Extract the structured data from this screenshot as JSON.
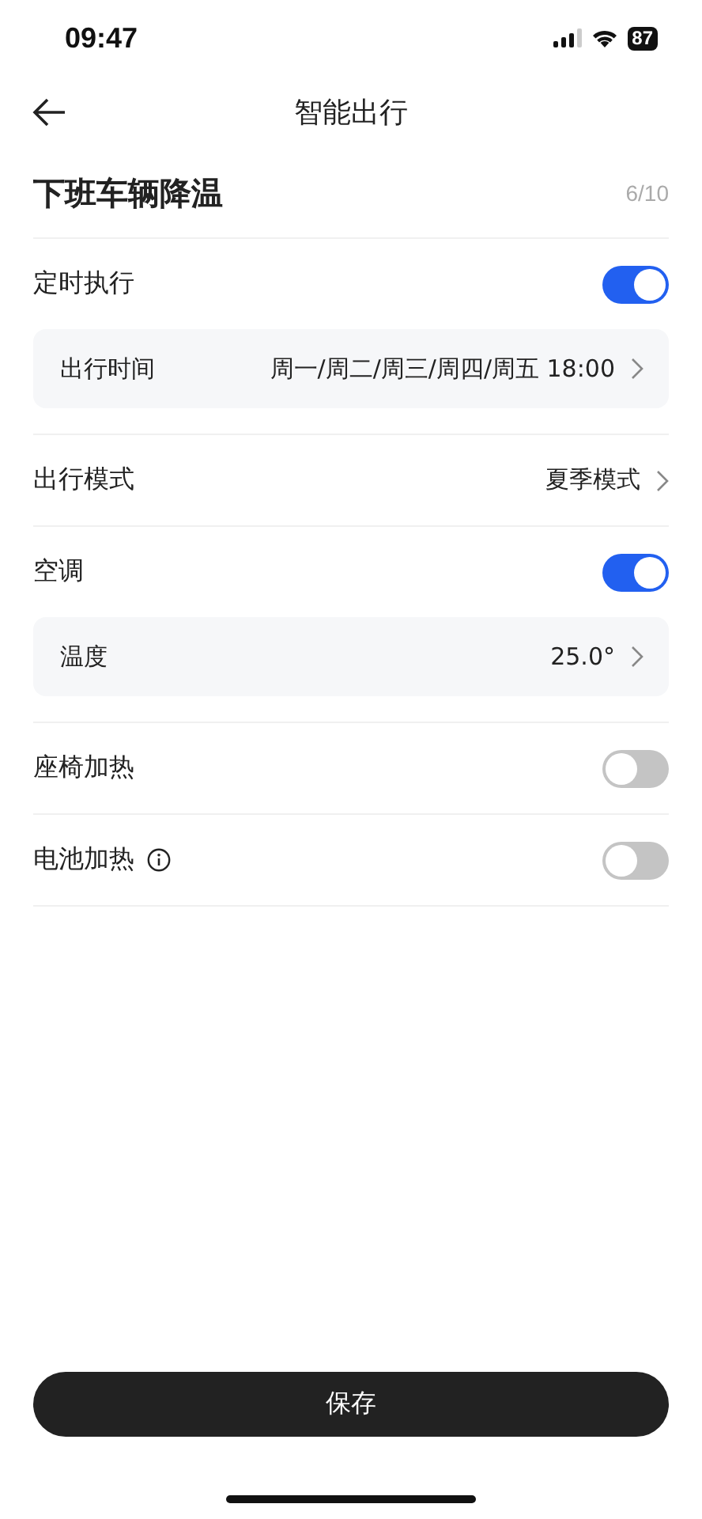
{
  "status_bar": {
    "time": "09:47",
    "battery": "87"
  },
  "nav": {
    "title": "智能出行"
  },
  "scene": {
    "name": "下班车辆降温",
    "count": "6/10"
  },
  "sections": [
    {
      "label": "定时执行",
      "kind": "toggle",
      "on": true,
      "sub": {
        "label": "出行时间",
        "value": "周一/周二/周三/周四/周五 18:00"
      }
    },
    {
      "label": "出行模式",
      "kind": "select",
      "value": "夏季模式"
    },
    {
      "label": "空调",
      "kind": "toggle",
      "on": true,
      "sub": {
        "label": "温度",
        "value": "25.0°"
      }
    },
    {
      "label": "座椅加热",
      "kind": "toggle",
      "on": false
    },
    {
      "label": "电池加热",
      "kind": "toggle",
      "on": false,
      "info": true
    }
  ],
  "save_button": "保存"
}
